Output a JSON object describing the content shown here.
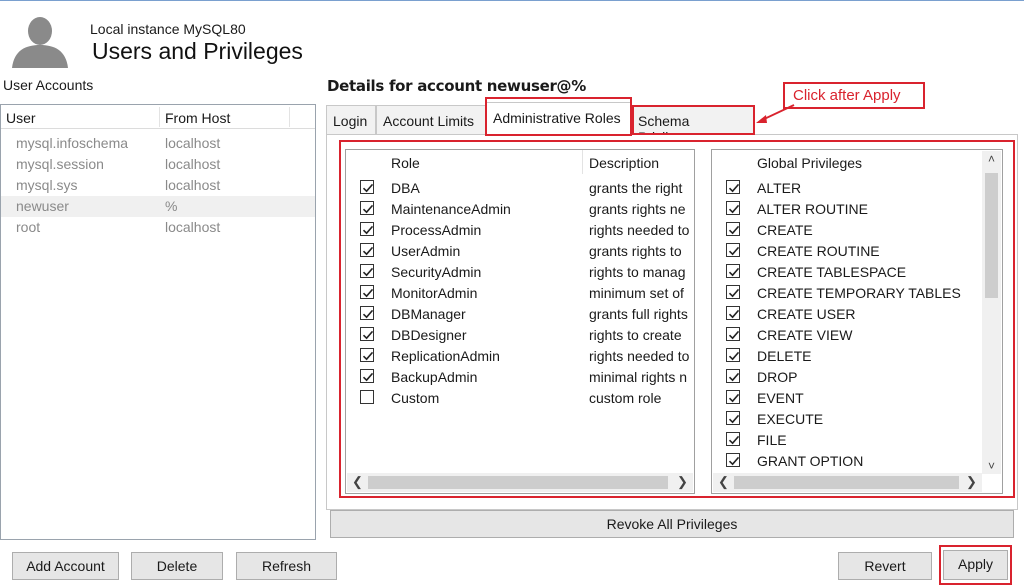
{
  "header": {
    "subtitle": "Local instance MySQL80",
    "title": "Users and Privileges"
  },
  "accounts": {
    "title": "User Accounts",
    "columns": [
      "User",
      "From Host"
    ],
    "rows": [
      {
        "user": "mysql.infoschema",
        "host": "localhost"
      },
      {
        "user": "mysql.session",
        "host": "localhost"
      },
      {
        "user": "mysql.sys",
        "host": "localhost"
      },
      {
        "user": "newuser",
        "host": "%"
      },
      {
        "user": "root",
        "host": "localhost"
      }
    ],
    "selected": "newuser"
  },
  "details": {
    "title": "Details for account newuser@%",
    "tabs": [
      "Login",
      "Account Limits",
      "Administrative Roles",
      "Schema Privileges"
    ],
    "active_tab": "Administrative Roles"
  },
  "annotation": {
    "text": "Click after Apply",
    "color": "#d9232e"
  },
  "roles": {
    "columns": [
      "Role",
      "Description"
    ],
    "rows": [
      {
        "role": "DBA",
        "desc": "grants the right",
        "checked": true
      },
      {
        "role": "MaintenanceAdmin",
        "desc": "grants rights ne",
        "checked": true
      },
      {
        "role": "ProcessAdmin",
        "desc": "rights needed to",
        "checked": true
      },
      {
        "role": "UserAdmin",
        "desc": "grants rights to",
        "checked": true
      },
      {
        "role": "SecurityAdmin",
        "desc": "rights to manag",
        "checked": true
      },
      {
        "role": "MonitorAdmin",
        "desc": "minimum set of",
        "checked": true
      },
      {
        "role": "DBManager",
        "desc": "grants full rights",
        "checked": true
      },
      {
        "role": "DBDesigner",
        "desc": "rights to create",
        "checked": true
      },
      {
        "role": "ReplicationAdmin",
        "desc": "rights needed to",
        "checked": true
      },
      {
        "role": "BackupAdmin",
        "desc": "minimal rights n",
        "checked": true
      },
      {
        "role": "Custom",
        "desc": "custom role",
        "checked": false
      }
    ]
  },
  "privileges": {
    "column": "Global Privileges",
    "rows": [
      {
        "name": "ALTER",
        "checked": true
      },
      {
        "name": "ALTER ROUTINE",
        "checked": true
      },
      {
        "name": "CREATE",
        "checked": true
      },
      {
        "name": "CREATE ROUTINE",
        "checked": true
      },
      {
        "name": "CREATE TABLESPACE",
        "checked": true
      },
      {
        "name": "CREATE TEMPORARY TABLES",
        "checked": true
      },
      {
        "name": "CREATE USER",
        "checked": true
      },
      {
        "name": "CREATE VIEW",
        "checked": true
      },
      {
        "name": "DELETE",
        "checked": true
      },
      {
        "name": "DROP",
        "checked": true
      },
      {
        "name": "EVENT",
        "checked": true
      },
      {
        "name": "EXECUTE",
        "checked": true
      },
      {
        "name": "FILE",
        "checked": true
      },
      {
        "name": "GRANT OPTION",
        "checked": true
      }
    ]
  },
  "buttons": {
    "revoke_all": "Revoke All Privileges",
    "add_account": "Add Account",
    "delete": "Delete",
    "refresh": "Refresh",
    "revert": "Revert",
    "apply": "Apply"
  },
  "icons": {
    "avatar": "user-silhouette-icon",
    "check": "checkmark-icon"
  }
}
